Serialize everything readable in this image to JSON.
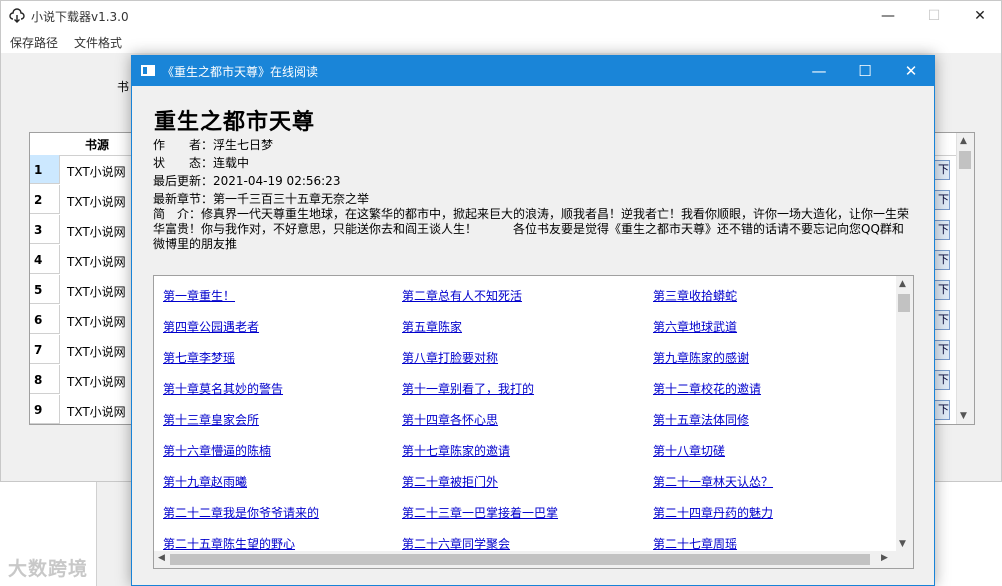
{
  "main_window": {
    "title": "小说下载器v1.3.0",
    "menu": [
      "保存路径",
      "文件格式"
    ],
    "book_label": "书",
    "grid": {
      "header": "书源",
      "rows": [
        {
          "index": "1",
          "source": "TXT小说网",
          "button": "下载"
        },
        {
          "index": "2",
          "source": "TXT小说网",
          "button": "下载"
        },
        {
          "index": "3",
          "source": "TXT小说网",
          "button": "下载"
        },
        {
          "index": "4",
          "source": "TXT小说网",
          "button": "下载"
        },
        {
          "index": "5",
          "source": "TXT小说网",
          "button": "下载"
        },
        {
          "index": "6",
          "source": "TXT小说网",
          "button": "下载"
        },
        {
          "index": "7",
          "source": "TXT小说网",
          "button": "下载"
        },
        {
          "index": "8",
          "source": "TXT小说网",
          "button": "下载"
        },
        {
          "index": "9",
          "source": "TXT小说网",
          "button": "下载"
        }
      ]
    }
  },
  "reader": {
    "title": "《重生之都市天尊》在线阅读",
    "book_title": "重生之都市天尊",
    "author": "作　　者：浮生七日梦",
    "status": "状　　态：连载中",
    "updated": "最后更新：2021-04-19 02:56:23",
    "latest": "最新章节：第一千三百三十五章无奈之举",
    "intro": "简　介：修真界一代天尊重生地球，在这繁华的都市中，掀起来巨大的浪涛，顺我者昌！逆我者亡！我看你顺眼，许你一场大造化，让你一生荣华富贵！你与我作对，不好意思，只能送你去和阎王谈人生！　　　各位书友要是觉得《重生之都市天尊》还不错的话请不要忘记向您QQ群和微博里的朋友推",
    "chapters": [
      "第一章重生！",
      "第二章总有人不知死活",
      "第三章收拾蟒蛇",
      "第四章公园遇老者",
      "第五章陈家",
      "第六章地球武道",
      "第七章李梦瑶",
      "第八章打脸要对称",
      "第九章陈家的感谢",
      "第十章莫名其妙的警告",
      "第十一章别看了，我打的",
      "第十二章校花的邀请",
      "第十三章皇家会所",
      "第十四章各怀心思",
      "第十五章法体同修",
      "第十六章懵逼的陈楠",
      "第十七章陈家的邀请",
      "第十八章切磋",
      "第十九章赵雨曦",
      "第二十章被拒门外",
      "第二十一章林天认怂？",
      "第二十二章我是你爷爷请来的",
      "第二十三章一巴掌接着一巴掌",
      "第二十四章丹药的魅力",
      "第二十五章陈生望的野心",
      "第二十六章同学聚会",
      "第二十七章周瑶"
    ]
  },
  "watermark": "大数跨境"
}
